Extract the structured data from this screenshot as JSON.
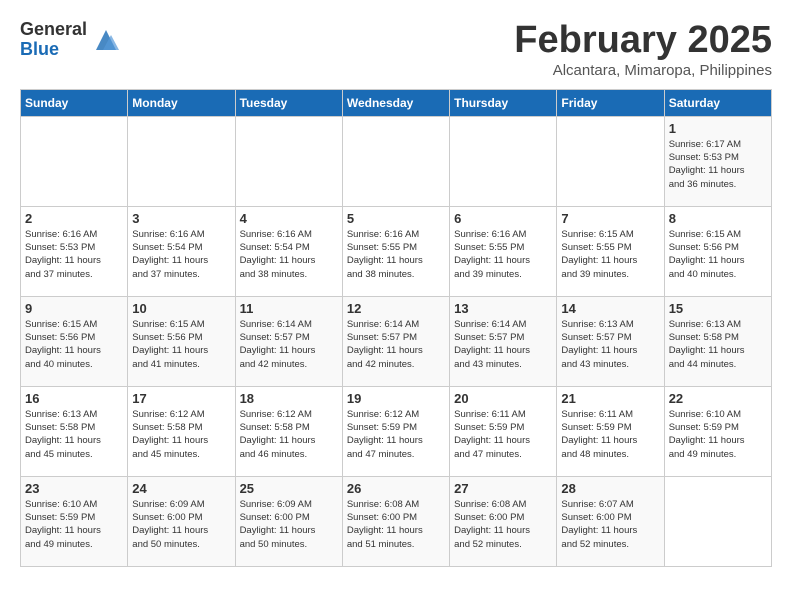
{
  "logo": {
    "general": "General",
    "blue": "Blue"
  },
  "title": "February 2025",
  "subtitle": "Alcantara, Mimaropa, Philippines",
  "headers": [
    "Sunday",
    "Monday",
    "Tuesday",
    "Wednesday",
    "Thursday",
    "Friday",
    "Saturday"
  ],
  "weeks": [
    [
      {
        "day": "",
        "info": ""
      },
      {
        "day": "",
        "info": ""
      },
      {
        "day": "",
        "info": ""
      },
      {
        "day": "",
        "info": ""
      },
      {
        "day": "",
        "info": ""
      },
      {
        "day": "",
        "info": ""
      },
      {
        "day": "1",
        "info": "Sunrise: 6:17 AM\nSunset: 5:53 PM\nDaylight: 11 hours\nand 36 minutes."
      }
    ],
    [
      {
        "day": "2",
        "info": "Sunrise: 6:16 AM\nSunset: 5:53 PM\nDaylight: 11 hours\nand 37 minutes."
      },
      {
        "day": "3",
        "info": "Sunrise: 6:16 AM\nSunset: 5:54 PM\nDaylight: 11 hours\nand 37 minutes."
      },
      {
        "day": "4",
        "info": "Sunrise: 6:16 AM\nSunset: 5:54 PM\nDaylight: 11 hours\nand 38 minutes."
      },
      {
        "day": "5",
        "info": "Sunrise: 6:16 AM\nSunset: 5:55 PM\nDaylight: 11 hours\nand 38 minutes."
      },
      {
        "day": "6",
        "info": "Sunrise: 6:16 AM\nSunset: 5:55 PM\nDaylight: 11 hours\nand 39 minutes."
      },
      {
        "day": "7",
        "info": "Sunrise: 6:15 AM\nSunset: 5:55 PM\nDaylight: 11 hours\nand 39 minutes."
      },
      {
        "day": "8",
        "info": "Sunrise: 6:15 AM\nSunset: 5:56 PM\nDaylight: 11 hours\nand 40 minutes."
      }
    ],
    [
      {
        "day": "9",
        "info": "Sunrise: 6:15 AM\nSunset: 5:56 PM\nDaylight: 11 hours\nand 40 minutes."
      },
      {
        "day": "10",
        "info": "Sunrise: 6:15 AM\nSunset: 5:56 PM\nDaylight: 11 hours\nand 41 minutes."
      },
      {
        "day": "11",
        "info": "Sunrise: 6:14 AM\nSunset: 5:57 PM\nDaylight: 11 hours\nand 42 minutes."
      },
      {
        "day": "12",
        "info": "Sunrise: 6:14 AM\nSunset: 5:57 PM\nDaylight: 11 hours\nand 42 minutes."
      },
      {
        "day": "13",
        "info": "Sunrise: 6:14 AM\nSunset: 5:57 PM\nDaylight: 11 hours\nand 43 minutes."
      },
      {
        "day": "14",
        "info": "Sunrise: 6:13 AM\nSunset: 5:57 PM\nDaylight: 11 hours\nand 43 minutes."
      },
      {
        "day": "15",
        "info": "Sunrise: 6:13 AM\nSunset: 5:58 PM\nDaylight: 11 hours\nand 44 minutes."
      }
    ],
    [
      {
        "day": "16",
        "info": "Sunrise: 6:13 AM\nSunset: 5:58 PM\nDaylight: 11 hours\nand 45 minutes."
      },
      {
        "day": "17",
        "info": "Sunrise: 6:12 AM\nSunset: 5:58 PM\nDaylight: 11 hours\nand 45 minutes."
      },
      {
        "day": "18",
        "info": "Sunrise: 6:12 AM\nSunset: 5:58 PM\nDaylight: 11 hours\nand 46 minutes."
      },
      {
        "day": "19",
        "info": "Sunrise: 6:12 AM\nSunset: 5:59 PM\nDaylight: 11 hours\nand 47 minutes."
      },
      {
        "day": "20",
        "info": "Sunrise: 6:11 AM\nSunset: 5:59 PM\nDaylight: 11 hours\nand 47 minutes."
      },
      {
        "day": "21",
        "info": "Sunrise: 6:11 AM\nSunset: 5:59 PM\nDaylight: 11 hours\nand 48 minutes."
      },
      {
        "day": "22",
        "info": "Sunrise: 6:10 AM\nSunset: 5:59 PM\nDaylight: 11 hours\nand 49 minutes."
      }
    ],
    [
      {
        "day": "23",
        "info": "Sunrise: 6:10 AM\nSunset: 5:59 PM\nDaylight: 11 hours\nand 49 minutes."
      },
      {
        "day": "24",
        "info": "Sunrise: 6:09 AM\nSunset: 6:00 PM\nDaylight: 11 hours\nand 50 minutes."
      },
      {
        "day": "25",
        "info": "Sunrise: 6:09 AM\nSunset: 6:00 PM\nDaylight: 11 hours\nand 50 minutes."
      },
      {
        "day": "26",
        "info": "Sunrise: 6:08 AM\nSunset: 6:00 PM\nDaylight: 11 hours\nand 51 minutes."
      },
      {
        "day": "27",
        "info": "Sunrise: 6:08 AM\nSunset: 6:00 PM\nDaylight: 11 hours\nand 52 minutes."
      },
      {
        "day": "28",
        "info": "Sunrise: 6:07 AM\nSunset: 6:00 PM\nDaylight: 11 hours\nand 52 minutes."
      },
      {
        "day": "",
        "info": ""
      }
    ]
  ]
}
